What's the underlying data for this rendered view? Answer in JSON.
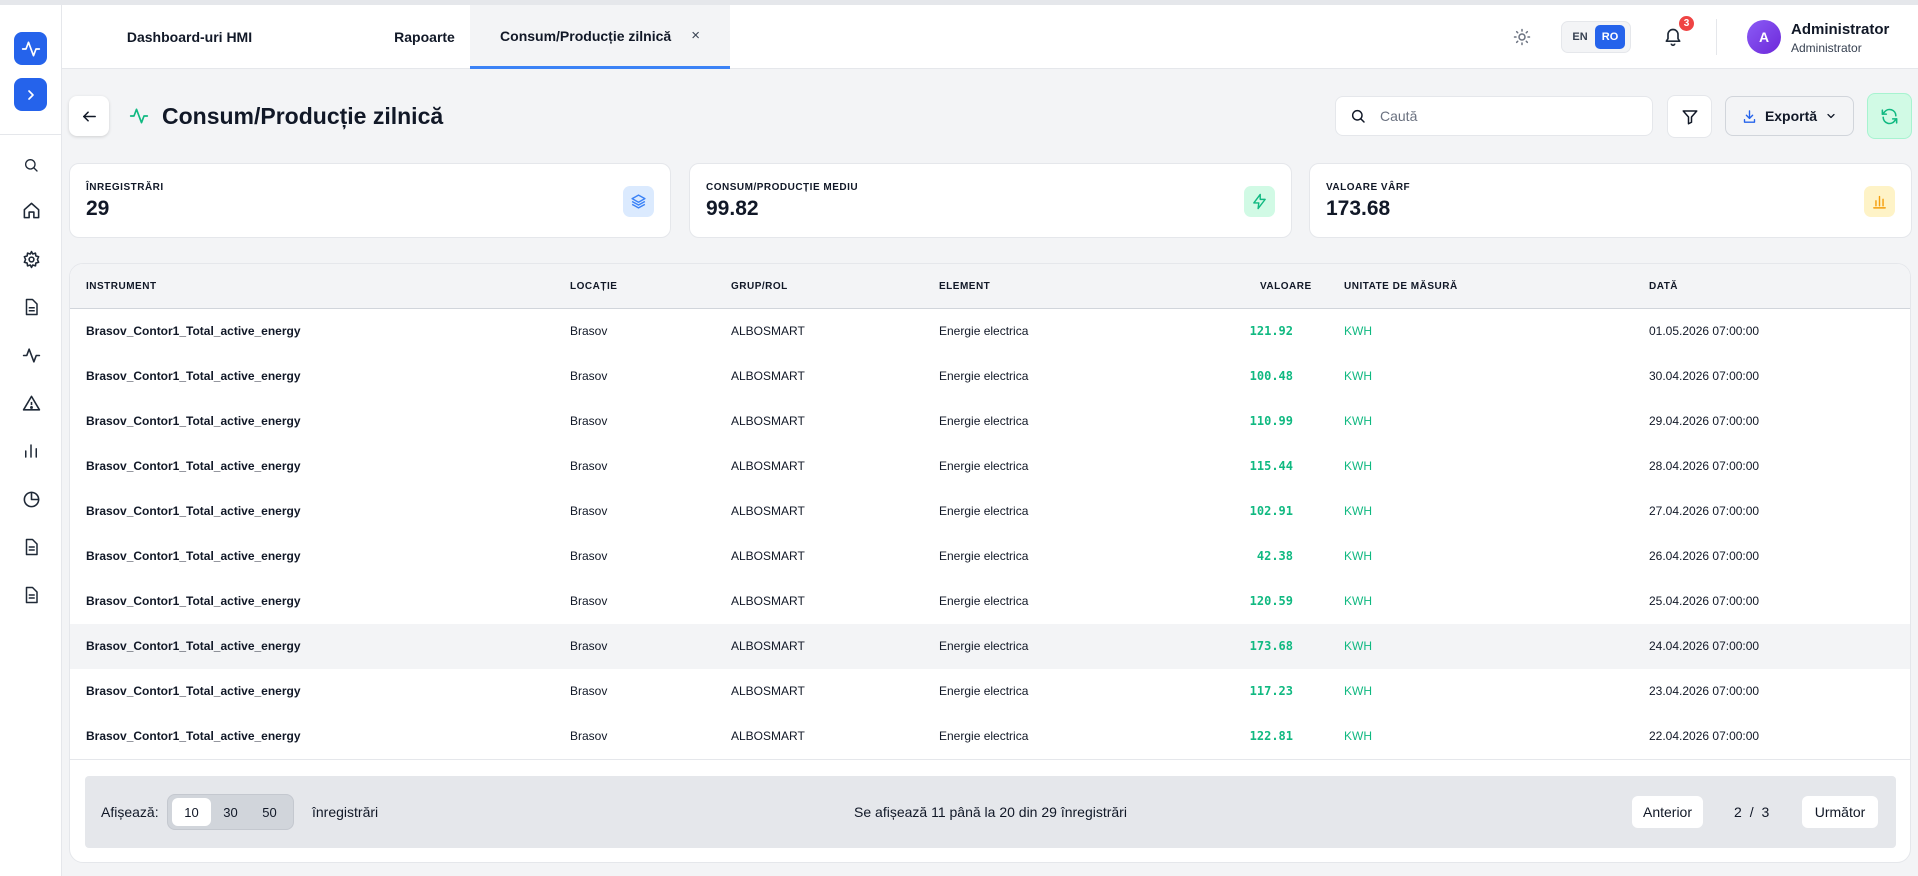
{
  "sidebar": {
    "items": [
      {
        "name": "search-icon"
      },
      {
        "name": "home-icon"
      },
      {
        "name": "gear-icon"
      },
      {
        "name": "document-icon"
      },
      {
        "name": "activity-icon"
      },
      {
        "name": "alert-icon"
      },
      {
        "name": "bar-chart-icon"
      },
      {
        "name": "pie-chart-icon"
      },
      {
        "name": "report-icon"
      },
      {
        "name": "report-alt-icon"
      }
    ]
  },
  "tabs": [
    {
      "label": "Dashboard-uri HMI"
    },
    {
      "label": "Rapoarte"
    },
    {
      "label": "Consum/Producție zilnică",
      "close": "×"
    }
  ],
  "header": {
    "lang": {
      "en": "EN",
      "ro": "RO"
    },
    "notifications_count": "3",
    "user": {
      "initial": "A",
      "name": "Administrator",
      "role": "Administrator"
    }
  },
  "page": {
    "title": "Consum/Producție zilnică",
    "search_placeholder": "Caută",
    "export_label": "Exportă"
  },
  "stats": [
    {
      "label": "Înregistrări",
      "value": "29",
      "icon": "layers-icon",
      "color": "#3b82f6"
    },
    {
      "label": "Consum/Producție mediu",
      "value": "99.82",
      "icon": "lightning-icon",
      "color": "#10b981"
    },
    {
      "label": "Valoare vârf",
      "value": "173.68",
      "icon": "bar-chart-icon",
      "color": "#f59e0b"
    }
  ],
  "table": {
    "columns": [
      "Instrument",
      "Locație",
      "Grup/Rol",
      "Element",
      "Valoare",
      "Unitate de măsură",
      "Dată"
    ],
    "rows": [
      {
        "instrument": "Brasov_Contor1_Total_active_energy",
        "location": "Brasov",
        "group": "ALBOSMART",
        "element": "Energie electrica",
        "value": "121.92",
        "unit": "KWH",
        "date": "01.05.2026 07:00:00"
      },
      {
        "instrument": "Brasov_Contor1_Total_active_energy",
        "location": "Brasov",
        "group": "ALBOSMART",
        "element": "Energie electrica",
        "value": "100.48",
        "unit": "KWH",
        "date": "30.04.2026 07:00:00"
      },
      {
        "instrument": "Brasov_Contor1_Total_active_energy",
        "location": "Brasov",
        "group": "ALBOSMART",
        "element": "Energie electrica",
        "value": "110.99",
        "unit": "KWH",
        "date": "29.04.2026 07:00:00"
      },
      {
        "instrument": "Brasov_Contor1_Total_active_energy",
        "location": "Brasov",
        "group": "ALBOSMART",
        "element": "Energie electrica",
        "value": "115.44",
        "unit": "KWH",
        "date": "28.04.2026 07:00:00"
      },
      {
        "instrument": "Brasov_Contor1_Total_active_energy",
        "location": "Brasov",
        "group": "ALBOSMART",
        "element": "Energie electrica",
        "value": "102.91",
        "unit": "KWH",
        "date": "27.04.2026 07:00:00"
      },
      {
        "instrument": "Brasov_Contor1_Total_active_energy",
        "location": "Brasov",
        "group": "ALBOSMART",
        "element": "Energie electrica",
        "value": "42.38",
        "unit": "KWH",
        "date": "26.04.2026 07:00:00"
      },
      {
        "instrument": "Brasov_Contor1_Total_active_energy",
        "location": "Brasov",
        "group": "ALBOSMART",
        "element": "Energie electrica",
        "value": "120.59",
        "unit": "KWH",
        "date": "25.04.2026 07:00:00"
      },
      {
        "instrument": "Brasov_Contor1_Total_active_energy",
        "location": "Brasov",
        "group": "ALBOSMART",
        "element": "Energie electrica",
        "value": "173.68",
        "unit": "KWH",
        "date": "24.04.2026 07:00:00",
        "highlighted": true
      },
      {
        "instrument": "Brasov_Contor1_Total_active_energy",
        "location": "Brasov",
        "group": "ALBOSMART",
        "element": "Energie electrica",
        "value": "117.23",
        "unit": "KWH",
        "date": "23.04.2026 07:00:00"
      },
      {
        "instrument": "Brasov_Contor1_Total_active_energy",
        "location": "Brasov",
        "group": "ALBOSMART",
        "element": "Energie electrica",
        "value": "122.81",
        "unit": "KWH",
        "date": "22.04.2026 07:00:00"
      }
    ]
  },
  "pagination": {
    "show_label": "Afișează:",
    "sizes": [
      "10",
      "30",
      "50"
    ],
    "selected_size": "10",
    "records_label": "înregistrări",
    "info": "Se afișează 11 până la 20 din 29 înregistrări",
    "prev_label": "Anterior",
    "next_label": "Următor",
    "current_page": "2",
    "separator": "/",
    "total_pages": "3"
  }
}
